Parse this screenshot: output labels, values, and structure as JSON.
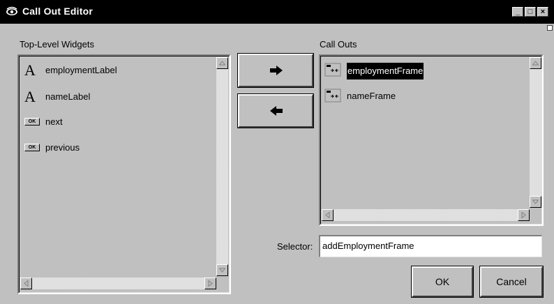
{
  "window": {
    "title": "Call Out Editor",
    "icon": "eye-icon"
  },
  "titlebar_buttons": {
    "minimize": "_",
    "maximize": "□",
    "close": "×"
  },
  "left_panel": {
    "label": "Top-Level Widgets",
    "items": [
      {
        "label": "employmentLabel",
        "icon": "label-A-icon"
      },
      {
        "label": "nameLabel",
        "icon": "label-A-icon"
      },
      {
        "label": "next",
        "icon": "ok-button-icon"
      },
      {
        "label": "previous",
        "icon": "ok-button-icon"
      }
    ],
    "ok_icon_text": "OK",
    "label_icon_text": "A"
  },
  "right_panel": {
    "label": "Call Outs",
    "items": [
      {
        "label": "employmentFrame",
        "icon": "frame-icon",
        "selected": true
      },
      {
        "label": "nameFrame",
        "icon": "frame-icon",
        "selected": false
      }
    ]
  },
  "move_buttons": {
    "add": "right-arrow-icon",
    "remove": "left-arrow-icon"
  },
  "selector": {
    "label": "Selector:",
    "value": "addEmploymentFrame"
  },
  "buttons": {
    "ok": "OK",
    "cancel": "Cancel"
  },
  "colors": {
    "titlebar": "#000000",
    "face": "#c0c0c0",
    "selection": "#000000"
  }
}
